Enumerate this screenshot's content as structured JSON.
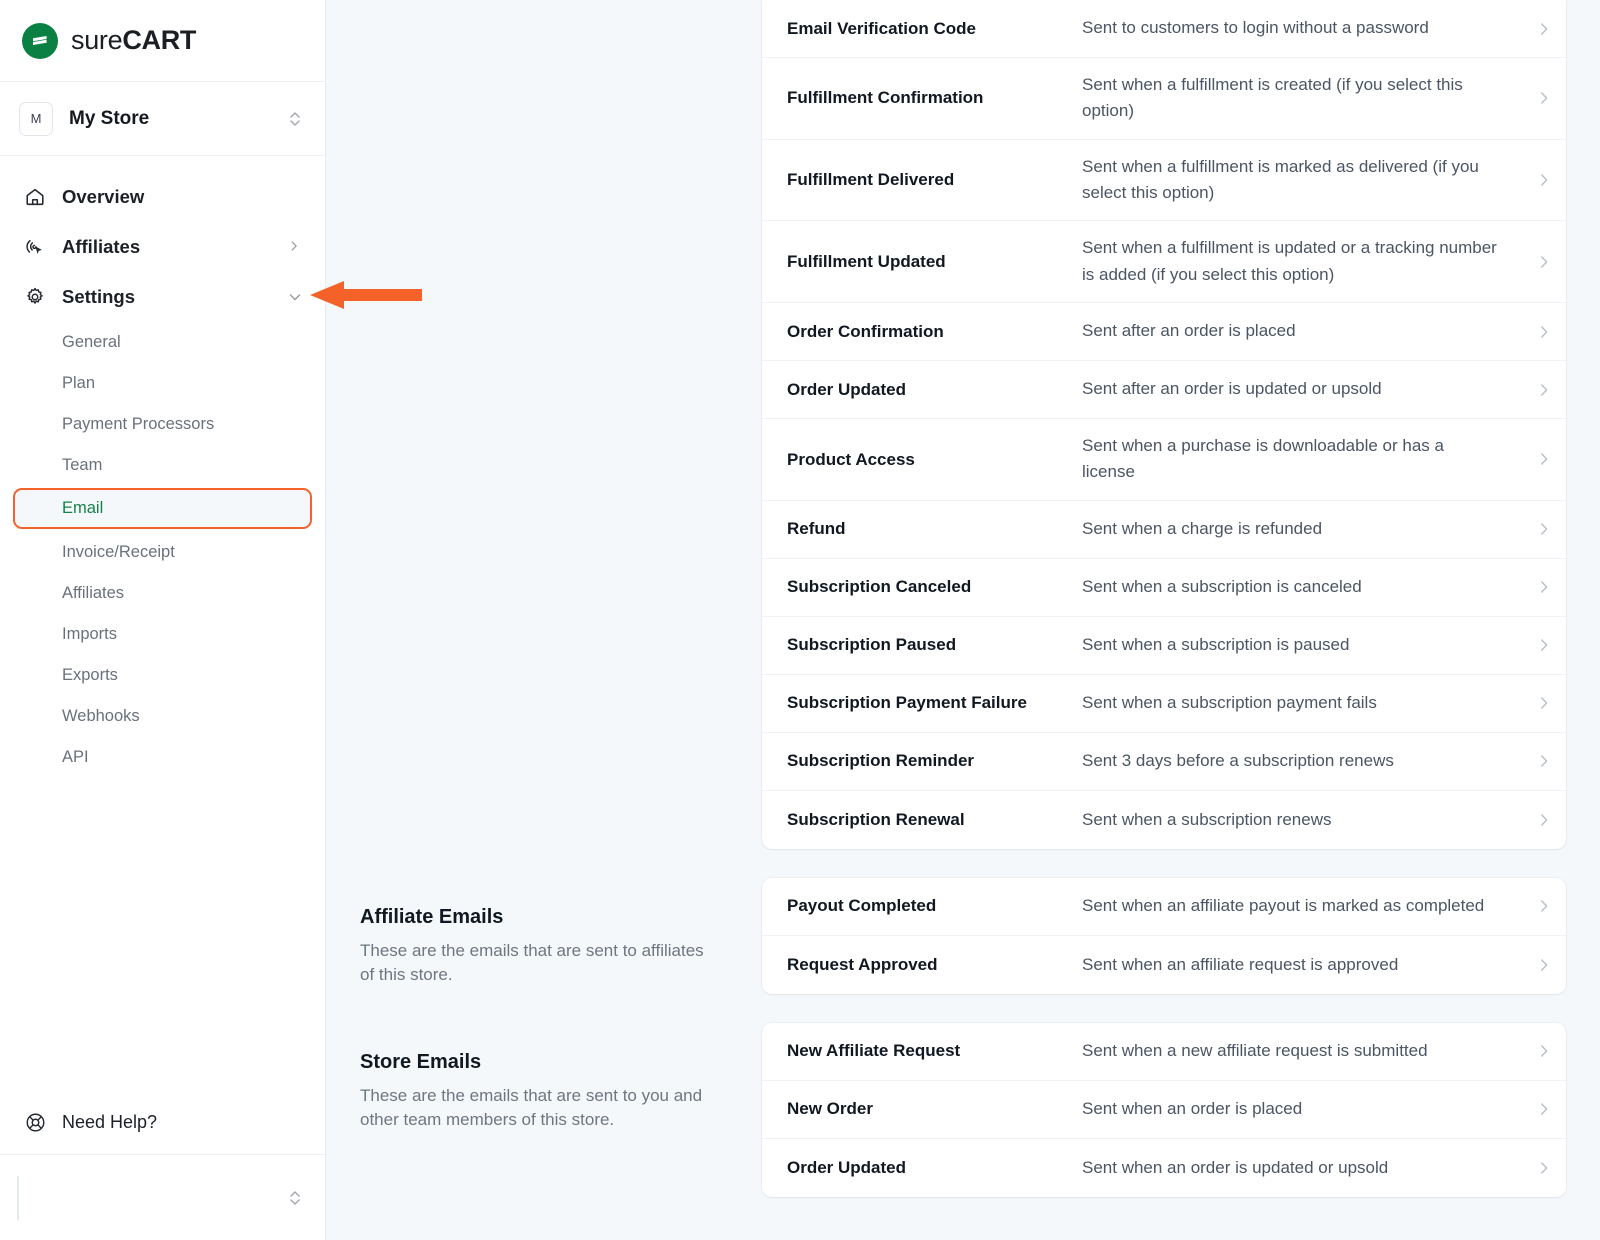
{
  "brand": {
    "logo_icon": "surecart-logo-icon",
    "name_light": "sure",
    "name_bold": "CART",
    "accent_green": "#0a8043"
  },
  "store_switcher": {
    "avatar_initial": "M",
    "name": "My Store",
    "icon": "chevron-up-down-icon"
  },
  "sidebar": {
    "nav": [
      {
        "label": "Overview",
        "icon": "home-icon",
        "caret": ""
      },
      {
        "label": "Affiliates",
        "icon": "affiliates-cursor-icon",
        "caret": "chevron-right-icon"
      },
      {
        "label": "Settings",
        "icon": "gear-icon",
        "caret": "chevron-down-icon"
      }
    ],
    "settings_children": [
      {
        "label": "General",
        "active": false
      },
      {
        "label": "Plan",
        "active": false
      },
      {
        "label": "Payment Processors",
        "active": false
      },
      {
        "label": "Team",
        "active": false
      },
      {
        "label": "Email",
        "active": true
      },
      {
        "label": "Invoice/Receipt",
        "active": false
      },
      {
        "label": "Affiliates",
        "active": false
      },
      {
        "label": "Imports",
        "active": false
      },
      {
        "label": "Exports",
        "active": false
      },
      {
        "label": "Webhooks",
        "active": false
      },
      {
        "label": "API",
        "active": false
      }
    ],
    "help": {
      "label": "Need Help?",
      "icon": "lifebuoy-icon"
    },
    "footer": {
      "icon": "chevron-up-down-icon"
    },
    "active_highlight_color": "#f4622a",
    "active_text_color": "#16824a"
  },
  "annotation": {
    "arrow_color": "#f4622a",
    "points_to": "settings-chevron-down-icon"
  },
  "sections": [
    {
      "id": "customer-emails",
      "title": "",
      "description": "",
      "clipped_top": true,
      "rows": [
        {
          "title": "Email Verification Code",
          "desc": "Sent to customers to login without a password"
        },
        {
          "title": "Fulfillment Confirmation",
          "desc": "Sent when a fulfillment is created (if you select this option)"
        },
        {
          "title": "Fulfillment Delivered",
          "desc": "Sent when a fulfillment is marked as delivered (if you select this option)"
        },
        {
          "title": "Fulfillment Updated",
          "desc": "Sent when a fulfillment is updated or a tracking number is added (if you select this option)"
        },
        {
          "title": "Order Confirmation",
          "desc": "Sent after an order is placed"
        },
        {
          "title": "Order Updated",
          "desc": "Sent after an order is updated or upsold"
        },
        {
          "title": "Product Access",
          "desc": "Sent when a purchase is downloadable or has a license"
        },
        {
          "title": "Refund",
          "desc": "Sent when a charge is refunded"
        },
        {
          "title": "Subscription Canceled",
          "desc": "Sent when a subscription is canceled"
        },
        {
          "title": "Subscription Paused",
          "desc": "Sent when a subscription is paused"
        },
        {
          "title": "Subscription Payment Failure",
          "desc": "Sent when a subscription payment fails"
        },
        {
          "title": "Subscription Reminder",
          "desc": "Sent 3 days before a subscription renews"
        },
        {
          "title": "Subscription Renewal",
          "desc": "Sent when a subscription renews"
        }
      ]
    },
    {
      "id": "affiliate-emails",
      "title": "Affiliate Emails",
      "description": "These are the emails that are sent to affiliates of this store.",
      "clipped_top": false,
      "rows": [
        {
          "title": "Payout Completed",
          "desc": "Sent when an affiliate payout is marked as completed"
        },
        {
          "title": "Request Approved",
          "desc": "Sent when an affiliate request is approved"
        }
      ]
    },
    {
      "id": "store-emails",
      "title": "Store Emails",
      "description": "These are the emails that are sent to you and other team members of this store.",
      "clipped_top": false,
      "rows": [
        {
          "title": "New Affiliate Request",
          "desc": "Sent when a new affiliate request is submitted"
        },
        {
          "title": "New Order",
          "desc": "Sent when an order is placed"
        },
        {
          "title": "Order Updated",
          "desc": "Sent when an order is updated or upsold"
        }
      ]
    }
  ],
  "row_chevron_icon": "chevron-right-icon"
}
